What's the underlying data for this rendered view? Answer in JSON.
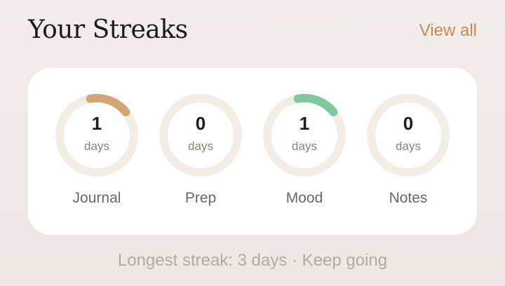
{
  "header": {
    "title": "Your Streaks",
    "view_all_label": "View all"
  },
  "colors": {
    "track": "#f4ede5",
    "journal_progress": "#d4a574",
    "mood_progress": "#7ec8a0",
    "view_all": "#c8845a"
  },
  "streaks": [
    {
      "value": "1",
      "unit": "days",
      "label": "Journal",
      "progress": 0.17,
      "color": "#d4a574"
    },
    {
      "value": "0",
      "unit": "days",
      "label": "Prep",
      "progress": 0,
      "color": "#d4a574"
    },
    {
      "value": "1",
      "unit": "days",
      "label": "Mood",
      "progress": 0.17,
      "color": "#7ec8a0"
    },
    {
      "value": "0",
      "unit": "days",
      "label": "Notes",
      "progress": 0,
      "color": "#d4a574"
    }
  ],
  "footer": {
    "text": "Longest streak: 3 days · Keep going"
  }
}
